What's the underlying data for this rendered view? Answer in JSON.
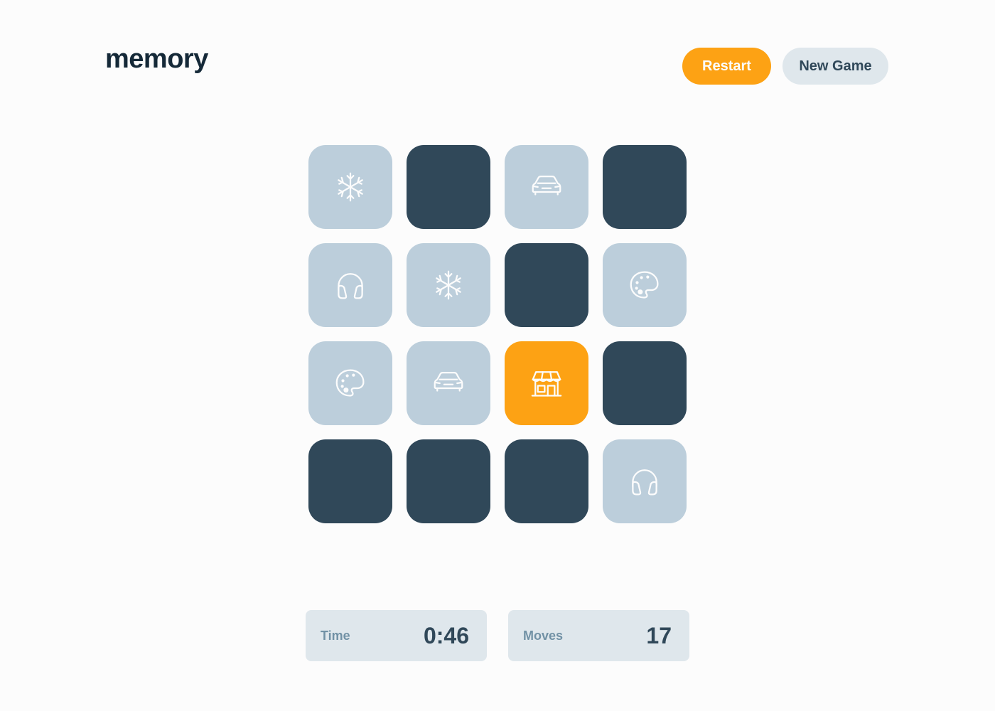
{
  "header": {
    "logo": "memory",
    "restart_label": "Restart",
    "new_game_label": "New Game"
  },
  "colors": {
    "background": "#fcfcfc",
    "dark_navy": "#152938",
    "tile_hidden": "#304859",
    "tile_matched": "#bccedb",
    "tile_active": "#fda214",
    "accent_orange": "#fda214",
    "stat_background": "#dfe7ec",
    "stat_label": "#7191a5"
  },
  "board": {
    "columns": 4,
    "rows": 4,
    "tiles": [
      {
        "state": "matched",
        "icon": "snowflake-icon"
      },
      {
        "state": "hidden",
        "icon": ""
      },
      {
        "state": "matched",
        "icon": "car-icon"
      },
      {
        "state": "hidden",
        "icon": ""
      },
      {
        "state": "matched",
        "icon": "headphones-icon"
      },
      {
        "state": "matched",
        "icon": "snowflake-icon"
      },
      {
        "state": "hidden",
        "icon": ""
      },
      {
        "state": "matched",
        "icon": "palette-icon"
      },
      {
        "state": "matched",
        "icon": "palette-icon"
      },
      {
        "state": "matched",
        "icon": "car-icon"
      },
      {
        "state": "active",
        "icon": "store-icon"
      },
      {
        "state": "hidden",
        "icon": ""
      },
      {
        "state": "hidden",
        "icon": ""
      },
      {
        "state": "hidden",
        "icon": ""
      },
      {
        "state": "hidden",
        "icon": ""
      },
      {
        "state": "matched",
        "icon": "headphones-icon"
      }
    ]
  },
  "stats": {
    "time_label": "Time",
    "time_value": "0:46",
    "moves_label": "Moves",
    "moves_value": "17"
  }
}
